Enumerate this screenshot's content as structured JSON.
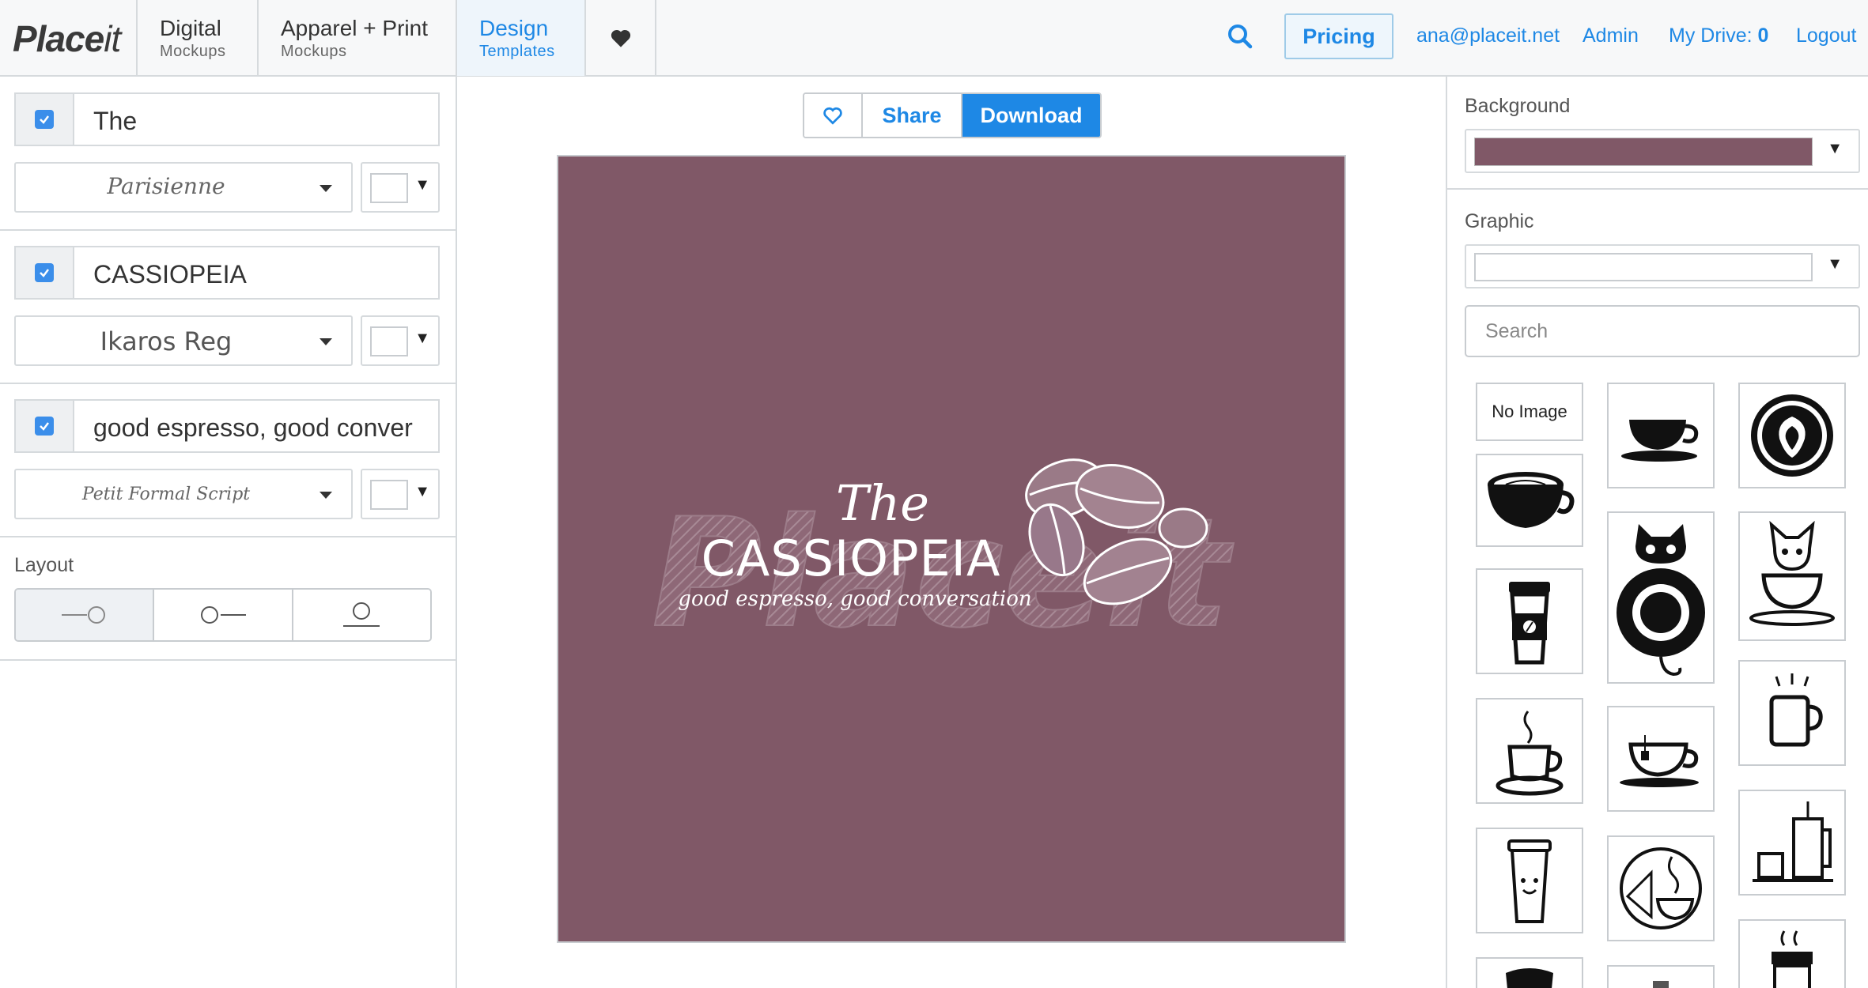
{
  "nav": {
    "logo_bold": "Place",
    "logo_light": "it",
    "tabs": [
      {
        "line1": "Digital",
        "line2": "Mockups"
      },
      {
        "line1": "Apparel + Print",
        "line2": "Mockups"
      },
      {
        "line1": "Design",
        "line2": "Templates"
      }
    ],
    "pricing": "Pricing",
    "email": "ana@placeit.net",
    "admin": "Admin",
    "my_drive_label": "My Drive:",
    "my_drive_count": "0",
    "logout": "Logout"
  },
  "text_layers": [
    {
      "checked": true,
      "text": "The",
      "font": "Parisienne"
    },
    {
      "checked": true,
      "text": "CASSIOPEIA",
      "font": "Ikaros Reg"
    },
    {
      "checked": true,
      "text": "good espresso, good conver",
      "font": "Petit Formal Script"
    }
  ],
  "layout": {
    "label": "Layout"
  },
  "actions": {
    "share": "Share",
    "download": "Download"
  },
  "design": {
    "background_color": "#805867",
    "title_script": "The",
    "title_main": "CASSIOPEIA",
    "tagline": "good espresso, good conversation",
    "watermark": "Placeit"
  },
  "right": {
    "background_label": "Background",
    "background_color": "#805867",
    "graphic_label": "Graphic",
    "search_placeholder": "Search",
    "no_image": "No Image"
  }
}
